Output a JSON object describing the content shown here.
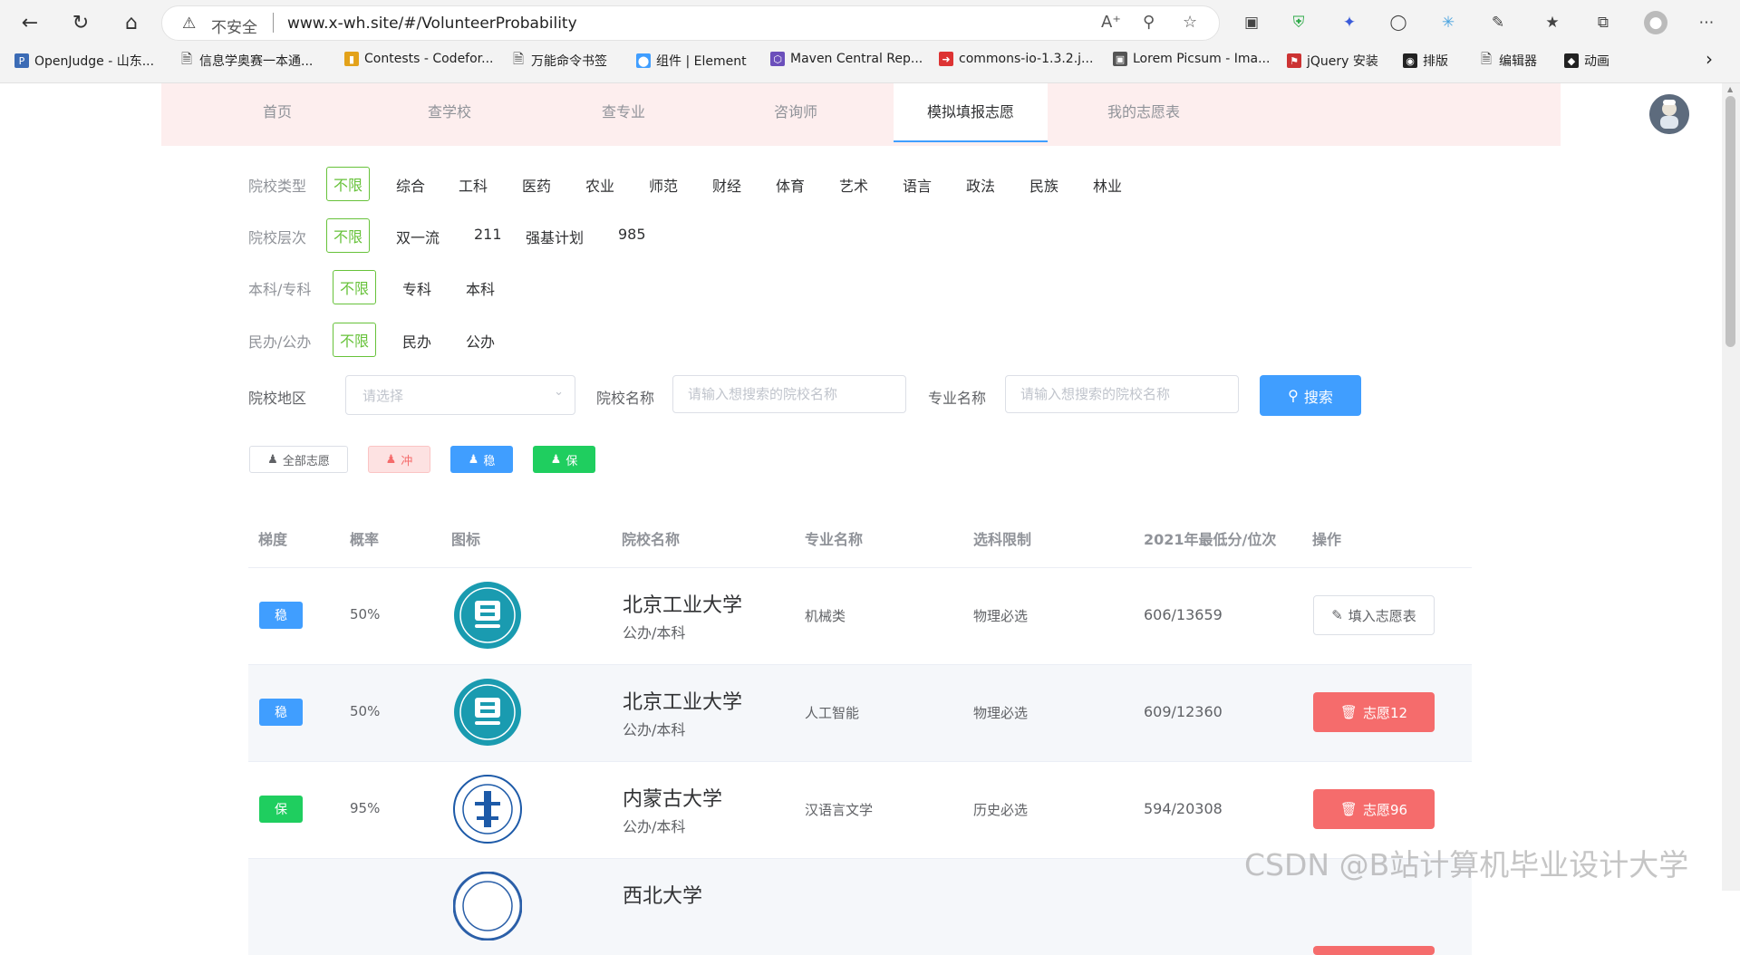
{
  "browser": {
    "insecure_label": "不安全",
    "url": "www.x-wh.site/#/VolunteerProbability",
    "bookmarks": [
      {
        "label": "OpenJudge - 山东...",
        "icon": "poj-icon"
      },
      {
        "label": "信息学奥赛一本通...",
        "icon": "page-icon"
      },
      {
        "label": "Contests - Codefor...",
        "icon": "codeforces-icon"
      },
      {
        "label": "万能命令书签",
        "icon": "page-icon"
      },
      {
        "label": "组件 | Element",
        "icon": "element-icon"
      },
      {
        "label": "Maven Central Rep...",
        "icon": "maven-icon"
      },
      {
        "label": "commons-io-1.3.2.j...",
        "icon": "mvn-repo-icon"
      },
      {
        "label": "Lorem Picsum - Ima...",
        "icon": "image-icon"
      },
      {
        "label": "jQuery 安装",
        "icon": "runoob-icon"
      },
      {
        "label": "排版",
        "icon": "github-icon"
      },
      {
        "label": "编辑器",
        "icon": "page-icon"
      },
      {
        "label": "动画",
        "icon": "diamond-icon"
      }
    ]
  },
  "nav": {
    "items": [
      "首页",
      "查学校",
      "查专业",
      "咨询师",
      "模拟填报志愿",
      "我的志愿表"
    ],
    "active_index": 4
  },
  "filters": {
    "type": {
      "label": "院校类型",
      "options": [
        "不限",
        "综合",
        "工科",
        "医药",
        "农业",
        "师范",
        "财经",
        "体育",
        "艺术",
        "语言",
        "政法",
        "民族",
        "林业"
      ]
    },
    "level": {
      "label": "院校层次",
      "options": [
        "不限",
        "双一流",
        "211",
        "强基计划",
        "985"
      ]
    },
    "degree": {
      "label": "本科/专科",
      "options": [
        "不限",
        "专科",
        "本科"
      ]
    },
    "ownership": {
      "label": "民办/公办",
      "options": [
        "不限",
        "民办",
        "公办"
      ]
    }
  },
  "search": {
    "region_label": "院校地区",
    "region_placeholder": "请选择",
    "school_label": "院校名称",
    "school_placeholder": "请输入想搜索的院校名称",
    "major_label": "专业名称",
    "major_placeholder": "请输入想搜索的院校名称",
    "button": "搜索"
  },
  "tags": {
    "all": "全部志愿",
    "rush": "冲",
    "steady": "稳",
    "safe": "保"
  },
  "table": {
    "headers": [
      "梯度",
      "概率",
      "图标",
      "院校名称",
      "专业名称",
      "选科限制",
      "2021年最低分/位次",
      "操作"
    ],
    "rows": [
      {
        "level": "稳",
        "prob": "50%",
        "school": "北京工业大学",
        "type": "公办/本科",
        "major": "机械类",
        "subject": "物理必选",
        "score": "606/13659",
        "action": "填入志愿表",
        "action_type": "fill"
      },
      {
        "level": "稳",
        "prob": "50%",
        "school": "北京工业大学",
        "type": "公办/本科",
        "major": "人工智能",
        "subject": "物理必选",
        "score": "609/12360",
        "action": "志愿12",
        "action_type": "remove"
      },
      {
        "level": "保",
        "prob": "95%",
        "school": "内蒙古大学",
        "type": "公办/本科",
        "major": "汉语言文学",
        "subject": "历史必选",
        "score": "594/20308",
        "action": "志愿96",
        "action_type": "remove"
      },
      {
        "level": "",
        "prob": "",
        "school": "西北大学",
        "type": "",
        "major": "",
        "subject": "",
        "score": "",
        "action": "",
        "action_type": "remove"
      }
    ]
  },
  "colors": {
    "steady": "#409eff",
    "safe": "#1fce5f",
    "rush_bg": "#fde2e2",
    "rush_text": "#f56c6c",
    "accent": "#409eff",
    "danger": "#f56c6c",
    "selected_option": "#67c23a"
  },
  "watermark": "CSDN @B站计算机毕业设计大学"
}
